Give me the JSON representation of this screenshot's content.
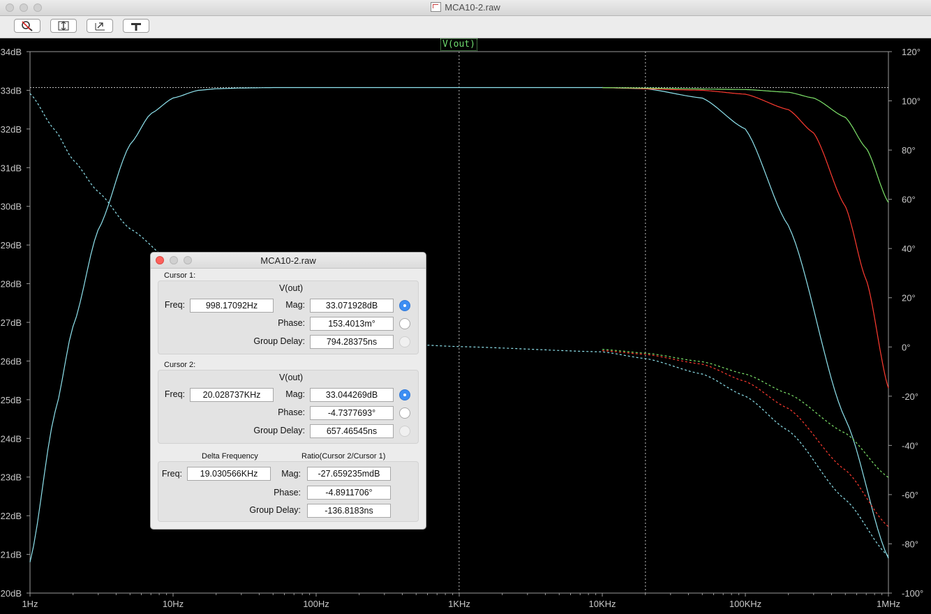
{
  "window": {
    "title": "MCA10-2.raw"
  },
  "toolbar": {
    "buttons": [
      "zoom-cancel-icon",
      "autorange-icon",
      "zoom-back-icon",
      "pan-hand-icon"
    ]
  },
  "plot": {
    "trace_label": "V(out)",
    "colors": {
      "cyan": "#8fe3ee",
      "red": "#ff3b30",
      "green": "#7ee36a",
      "grid": "#8a8a8a"
    }
  },
  "chart_data": {
    "type": "line",
    "x_scale": "log",
    "xlim": [
      1,
      1000000
    ],
    "ylim_left": [
      20,
      34
    ],
    "ylim_right": [
      -100,
      120
    ],
    "ylabel_left_unit": "dB",
    "ylabel_right_unit": "°",
    "x_ticks": [
      "1Hz",
      "10Hz",
      "100Hz",
      "1KHz",
      "10KHz",
      "100KHz",
      "1MHz"
    ],
    "y_ticks_left": [
      "34dB",
      "33dB",
      "32dB",
      "31dB",
      "30dB",
      "29dB",
      "28dB",
      "27dB",
      "26dB",
      "25dB",
      "24dB",
      "23dB",
      "22dB",
      "21dB",
      "20dB"
    ],
    "y_ticks_right": [
      "120°",
      "100°",
      "80°",
      "60°",
      "40°",
      "20°",
      "0°",
      "-20°",
      "-40°",
      "-60°",
      "-80°",
      "-100°"
    ],
    "cursors_hz": [
      998.17092,
      20028.737
    ],
    "cursor_mag_db": 33.07,
    "series": [
      {
        "color": "#8fe3ee",
        "style": "solid",
        "axis": "left",
        "x": [
          1,
          1.5,
          2,
          3,
          5,
          7,
          10,
          15,
          20,
          30,
          50,
          100,
          1000,
          10000,
          20000,
          50000,
          100000,
          200000,
          500000,
          1000000
        ],
        "y": [
          20.8,
          24.7,
          26.9,
          29.4,
          31.6,
          32.4,
          32.8,
          33.0,
          33.04,
          33.06,
          33.07,
          33.07,
          33.07,
          33.07,
          33.04,
          32.8,
          32.0,
          29.5,
          24.5,
          20.9
        ]
      },
      {
        "color": "#ff3b30",
        "style": "solid",
        "axis": "left",
        "x": [
          10000,
          50000,
          100000,
          200000,
          300000,
          500000,
          700000,
          1000000
        ],
        "y": [
          33.07,
          33.0,
          32.9,
          32.5,
          31.9,
          30.0,
          28.1,
          25.3
        ]
      },
      {
        "color": "#7ee36a",
        "style": "solid",
        "axis": "left",
        "x": [
          10000,
          100000,
          200000,
          300000,
          500000,
          700000,
          1000000
        ],
        "y": [
          33.07,
          33.02,
          32.95,
          32.8,
          32.3,
          31.5,
          30.1
        ]
      },
      {
        "color": "#8fe3ee",
        "style": "dashed",
        "axis": "right",
        "x": [
          1,
          1.5,
          2,
          3,
          5,
          10,
          20,
          50,
          100,
          1000,
          10000,
          20000,
          50000,
          100000,
          200000,
          500000,
          1000000
        ],
        "y": [
          103,
          88,
          76,
          63,
          48,
          34,
          17,
          7,
          3.3,
          0.15,
          -2,
          -4.7,
          -11,
          -20,
          -34,
          -62,
          -85
        ]
      },
      {
        "color": "#ff3b30",
        "style": "dashed",
        "axis": "right",
        "x": [
          10000,
          20000,
          50000,
          100000,
          200000,
          500000,
          1000000
        ],
        "y": [
          -1.5,
          -3,
          -7,
          -14,
          -25,
          -50,
          -73
        ]
      },
      {
        "color": "#7ee36a",
        "style": "dashed",
        "axis": "right",
        "x": [
          10000,
          20000,
          50000,
          100000,
          200000,
          500000,
          1000000
        ],
        "y": [
          -1,
          -2.5,
          -6,
          -11,
          -19,
          -35,
          -53
        ]
      }
    ]
  },
  "dialog": {
    "title": "MCA10-2.raw",
    "cursor1": {
      "heading": "Cursor 1:",
      "trace": "V(out)",
      "freq_label": "Freq:",
      "freq": "998.17092Hz",
      "mag_label": "Mag:",
      "mag": "33.071928dB",
      "phase_label": "Phase:",
      "phase": "153.4013m°",
      "gd_label": "Group Delay:",
      "gd": "794.28375ns"
    },
    "cursor2": {
      "heading": "Cursor 2:",
      "trace": "V(out)",
      "freq_label": "Freq:",
      "freq": "20.028737KHz",
      "mag_label": "Mag:",
      "mag": "33.044269dB",
      "phase_label": "Phase:",
      "phase": "-4.7377693°",
      "gd_label": "Group Delay:",
      "gd": "657.46545ns"
    },
    "delta": {
      "freq_heading": "Delta Frequency",
      "ratio_heading": "Ratio(Cursor 2/Cursor 1)",
      "freq_label": "Freq:",
      "freq": "19.030566KHz",
      "mag_label": "Mag:",
      "mag": "-27.659235mdB",
      "phase_label": "Phase:",
      "phase": "-4.8911706°",
      "gd_label": "Group Delay:",
      "gd": "-136.8183ns"
    }
  }
}
